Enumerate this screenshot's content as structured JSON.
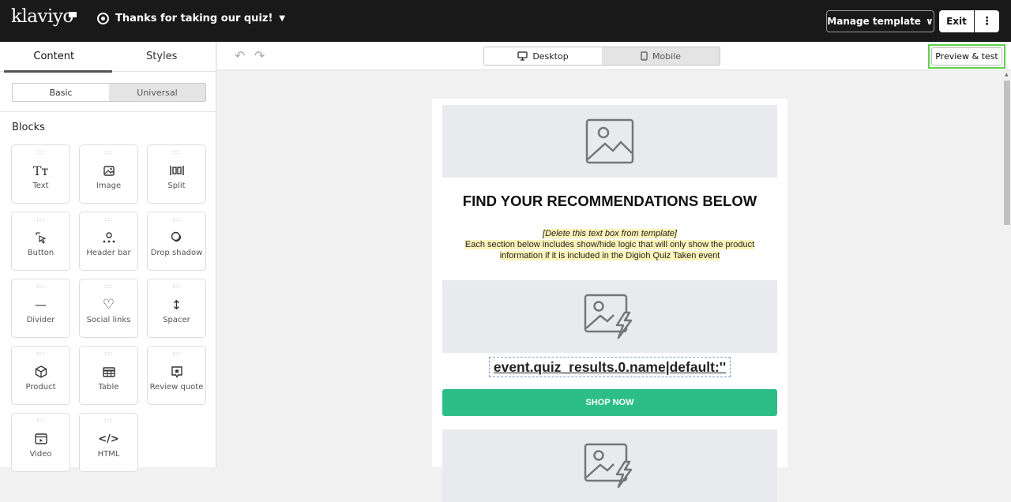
{
  "header": {
    "logo": "klaviyo",
    "campaign_title": "Thanks for taking our quiz!",
    "caret": "▼",
    "manage_template": "Manage template",
    "manage_chevron": "∨",
    "exit": "Exit",
    "more": "⋮"
  },
  "sidebar": {
    "tabs": [
      "Content",
      "Styles"
    ],
    "segments": [
      "Basic",
      "Universal"
    ],
    "blocks_title": "Blocks",
    "grip": ":::",
    "blocks": [
      {
        "label": "Text",
        "icon": "text-icon",
        "glyph": "Tт"
      },
      {
        "label": "Image",
        "icon": "image-icon",
        "glyph": ""
      },
      {
        "label": "Split",
        "icon": "split-icon",
        "glyph": "|▯▯|"
      },
      {
        "label": "Button",
        "icon": "cursor-click-icon",
        "glyph": "☝"
      },
      {
        "label": "Header bar",
        "icon": "header-bar-icon",
        "glyph": ""
      },
      {
        "label": "Drop shadow",
        "icon": "drop-shadow-icon",
        "glyph": ""
      },
      {
        "label": "Divider",
        "icon": "divider-icon",
        "glyph": "—"
      },
      {
        "label": "Social links",
        "icon": "heart-icon",
        "glyph": "♡"
      },
      {
        "label": "Spacer",
        "icon": "spacer-icon",
        "glyph": "↕"
      },
      {
        "label": "Product",
        "icon": "product-box-icon",
        "glyph": ""
      },
      {
        "label": "Table",
        "icon": "table-icon",
        "glyph": "⊞"
      },
      {
        "label": "Review quote",
        "icon": "review-quote-icon",
        "glyph": ""
      },
      {
        "label": "Video",
        "icon": "video-icon",
        "glyph": ""
      },
      {
        "label": "HTML",
        "icon": "html-code-icon",
        "glyph": "</>"
      }
    ]
  },
  "toolbar": {
    "undo": "↶",
    "redo": "↷",
    "desktop": "Desktop",
    "mobile": "Mobile",
    "preview": "Preview & test"
  },
  "email": {
    "heading": "FIND YOUR RECOMMENDATIONS BELOW",
    "note_line1": "[Delete this text box from template]",
    "note_line2": "Each section below includes show/hide logic that will only show the product",
    "note_line3": "information if it is included in the Digioh Quiz Taken event",
    "product_name": "event.quiz_results.0.name|default:''",
    "shop_now": "SHOP NOW"
  },
  "colors": {
    "topbar": "#191919",
    "accent_green": "#2dbe87",
    "highlight_border": "#5fd14a",
    "note_highlight": "#fdf3b8"
  }
}
